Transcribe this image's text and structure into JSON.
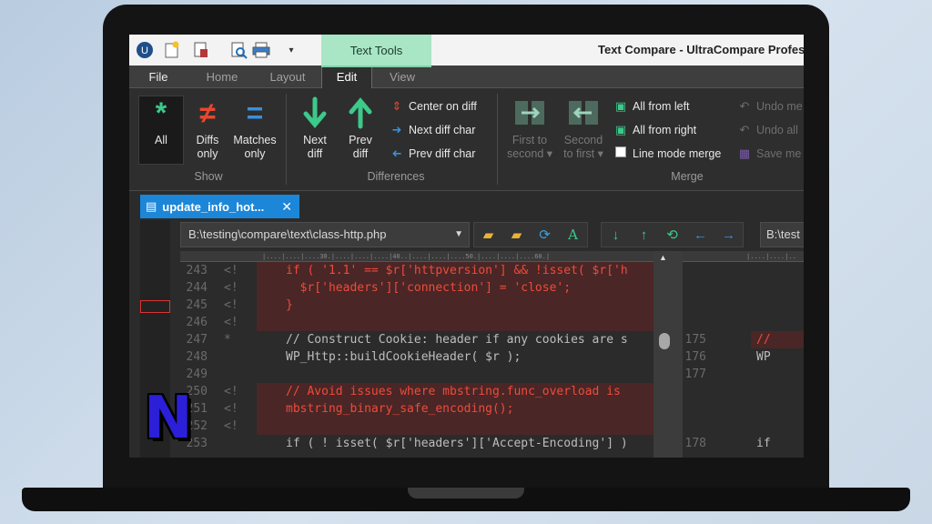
{
  "app": {
    "window_title": "Text Compare - UltraCompare Profes",
    "context_tab": "Text Tools"
  },
  "quick_access": [
    "app-logo-icon",
    "new-file-icon",
    "report-icon",
    "print-preview-icon",
    "print-icon",
    "qat-customize-icon"
  ],
  "menu_tabs": [
    "File",
    "Home",
    "Layout",
    "Edit",
    "View"
  ],
  "active_tab": "Edit",
  "ribbon": {
    "show": {
      "label": "Show",
      "buttons": [
        {
          "line1": "All",
          "line2": "",
          "icon": "*",
          "color": "#3cc98a"
        },
        {
          "line1": "Diffs",
          "line2": "only",
          "icon": "≠",
          "color": "#e8472d"
        },
        {
          "line1": "Matches",
          "line2": "only",
          "icon": "=",
          "color": "#3b8fdc"
        }
      ]
    },
    "differences": {
      "label": "Differences",
      "next": {
        "line1": "Next",
        "line2": "diff"
      },
      "prev": {
        "line1": "Prev",
        "line2": "diff"
      },
      "center": "Center on diff",
      "next_char": "Next diff char",
      "prev_char": "Prev diff char"
    },
    "merge": {
      "label": "Merge",
      "first_to_second": {
        "line1": "First to",
        "line2": "second ▾"
      },
      "second_to_first": {
        "line1": "Second",
        "line2": "to first ▾"
      },
      "all_from_left": "All from left",
      "all_from_right": "All from right",
      "line_mode_merge": "Line mode merge",
      "undo_merge": "Undo me",
      "undo_all": "Undo all",
      "save_merge": "Save me"
    }
  },
  "document_tab": {
    "title": "update_info_hot...",
    "close": "✕"
  },
  "left_path": "B:\\testing\\compare\\text\\class-http.php",
  "right_path": "B:\\test",
  "ruler_left": "|....|....|....30.|....|....|....|40..|....|....|....50.|....|....|....60.|",
  "ruler_right": "|....|....|..",
  "left_lines": [
    {
      "num": "243",
      "mark": "<!",
      "code": "if ( '1.1' == $r['httpversion'] && !isset( $r['h",
      "state": "diff"
    },
    {
      "num": "244",
      "mark": "<!",
      "code": "  $r['headers']['connection'] = 'close';",
      "state": "diff"
    },
    {
      "num": "245",
      "mark": "<!",
      "code": "}",
      "state": "diff"
    },
    {
      "num": "246",
      "mark": "<!",
      "code": "",
      "state": "diff"
    },
    {
      "num": "247",
      "mark": "*",
      "code": "// Construct Cookie: header if any cookies are s",
      "state": "same"
    },
    {
      "num": "248",
      "mark": "",
      "code": "WP_Http::buildCookieHeader( $r );",
      "state": "same"
    },
    {
      "num": "249",
      "mark": "",
      "code": "",
      "state": "same"
    },
    {
      "num": "250",
      "mark": "<!",
      "code": "// Avoid issues where mbstring.func_overload is",
      "state": "diff"
    },
    {
      "num": "251",
      "mark": "<!",
      "code": "mbstring_binary_safe_encoding();",
      "state": "diff"
    },
    {
      "num": "252",
      "mark": "<!",
      "code": "",
      "state": "diff"
    },
    {
      "num": "253",
      "mark": "",
      "code": "if ( ! isset( $r['headers']['Accept-Encoding'] )",
      "state": "same"
    }
  ],
  "right_lines": [
    {
      "num": "",
      "code": "",
      "state": "blank"
    },
    {
      "num": "",
      "code": "",
      "state": "blank"
    },
    {
      "num": "",
      "code": "",
      "state": "blank"
    },
    {
      "num": "",
      "code": "",
      "state": "blank"
    },
    {
      "num": "175",
      "code": "//",
      "state": "diff"
    },
    {
      "num": "176",
      "code": "WP",
      "state": "same"
    },
    {
      "num": "177",
      "code": "",
      "state": "same"
    },
    {
      "num": "",
      "code": "",
      "state": "blank"
    },
    {
      "num": "",
      "code": "",
      "state": "blank"
    },
    {
      "num": "",
      "code": "",
      "state": "blank"
    },
    {
      "num": "178",
      "code": "if",
      "state": "same"
    }
  ],
  "overlay_logo": "N"
}
